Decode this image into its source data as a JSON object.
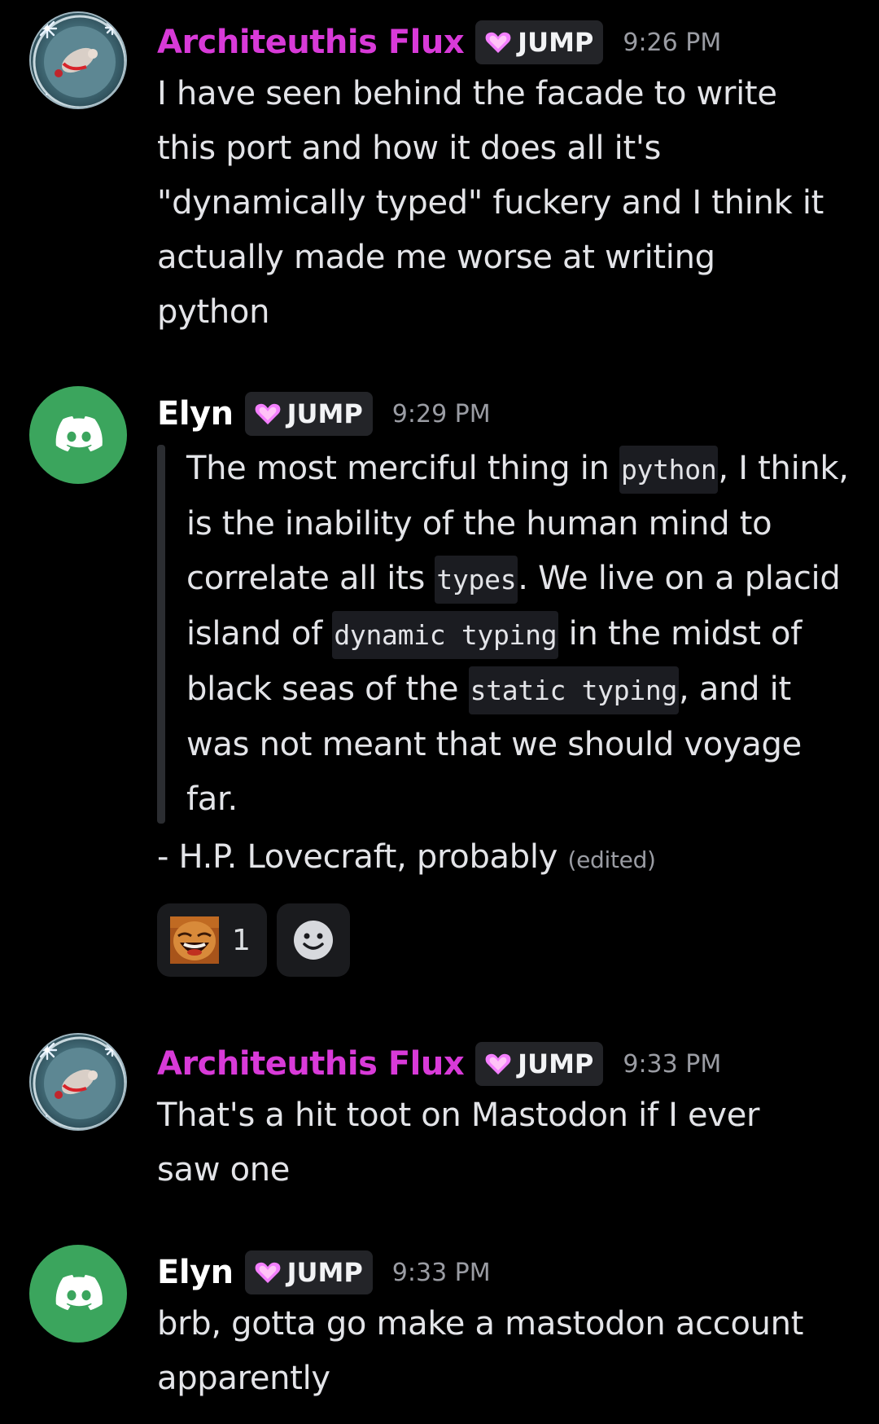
{
  "colors": {
    "background": "#000000",
    "flux_name": "#d83ad8",
    "elyn_name": "#ffffff",
    "tag_bg": "#232428",
    "discord_green": "#3ba55d",
    "timestamp": "#9a9ca3"
  },
  "messages": [
    {
      "author": "Architeuthis Flux",
      "avatar_icon": "winter-wreath-avatar",
      "tag": "JUMP",
      "tag_icon": "pink-heart-icon",
      "time": "9:26 PM",
      "lines": [
        "I have seen behind the facade to write",
        "this port and how it does all it's",
        "\"dynamically typed\" fuckery and I think it",
        "actually made me worse at writing",
        "python"
      ]
    },
    {
      "author": "Elyn",
      "avatar_icon": "discord-logo-avatar",
      "tag": "JUMP",
      "tag_icon": "pink-heart-icon",
      "time": "9:29 PM",
      "quote": {
        "t1": "The most merciful thing in ",
        "c1": "python",
        "t2": ", I think, is the inability of the human mind to correlate all its ",
        "c2": "types",
        "t3": ". We live on a placid island of ",
        "c3": "dynamic typing",
        "t4": " in the midst of black seas of the ",
        "c4": "static typing",
        "t5": ", and it was not meant that we should voyage far."
      },
      "attribution": "- H.P. Lovecraft, probably",
      "edited": "(edited)",
      "reactions": [
        {
          "emoji_icon": "laughing-face-emoji",
          "count": "1"
        }
      ],
      "add_reaction_icon": "add-reaction-smiley-icon"
    },
    {
      "author": "Architeuthis Flux",
      "avatar_icon": "winter-wreath-avatar",
      "tag": "JUMP",
      "tag_icon": "pink-heart-icon",
      "time": "9:33 PM",
      "lines": [
        "That's a hit toot on Mastodon if I ever",
        "saw one"
      ]
    },
    {
      "author": "Elyn",
      "avatar_icon": "discord-logo-avatar",
      "tag": "JUMP",
      "tag_icon": "pink-heart-icon",
      "time": "9:33 PM",
      "lines": [
        "brb, gotta go make a mastodon account",
        "apparently"
      ]
    }
  ]
}
